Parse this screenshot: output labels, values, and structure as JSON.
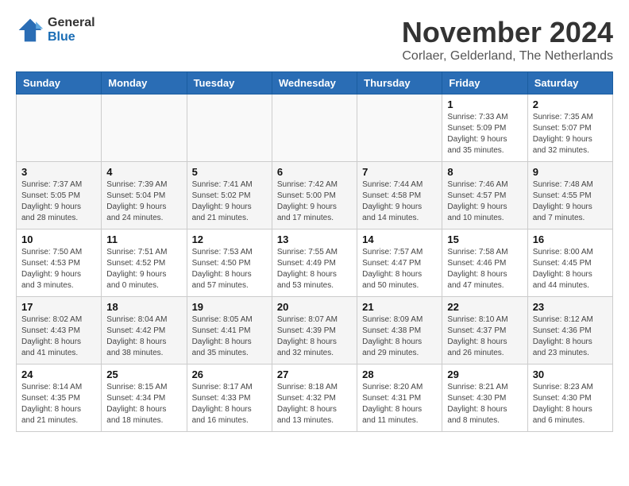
{
  "logo": {
    "general": "General",
    "blue": "Blue"
  },
  "header": {
    "title": "November 2024",
    "subtitle": "Corlaer, Gelderland, The Netherlands"
  },
  "weekdays": [
    "Sunday",
    "Monday",
    "Tuesday",
    "Wednesday",
    "Thursday",
    "Friday",
    "Saturday"
  ],
  "weeks": [
    [
      {
        "day": "",
        "info": ""
      },
      {
        "day": "",
        "info": ""
      },
      {
        "day": "",
        "info": ""
      },
      {
        "day": "",
        "info": ""
      },
      {
        "day": "",
        "info": ""
      },
      {
        "day": "1",
        "info": "Sunrise: 7:33 AM\nSunset: 5:09 PM\nDaylight: 9 hours\nand 35 minutes."
      },
      {
        "day": "2",
        "info": "Sunrise: 7:35 AM\nSunset: 5:07 PM\nDaylight: 9 hours\nand 32 minutes."
      }
    ],
    [
      {
        "day": "3",
        "info": "Sunrise: 7:37 AM\nSunset: 5:05 PM\nDaylight: 9 hours\nand 28 minutes."
      },
      {
        "day": "4",
        "info": "Sunrise: 7:39 AM\nSunset: 5:04 PM\nDaylight: 9 hours\nand 24 minutes."
      },
      {
        "day": "5",
        "info": "Sunrise: 7:41 AM\nSunset: 5:02 PM\nDaylight: 9 hours\nand 21 minutes."
      },
      {
        "day": "6",
        "info": "Sunrise: 7:42 AM\nSunset: 5:00 PM\nDaylight: 9 hours\nand 17 minutes."
      },
      {
        "day": "7",
        "info": "Sunrise: 7:44 AM\nSunset: 4:58 PM\nDaylight: 9 hours\nand 14 minutes."
      },
      {
        "day": "8",
        "info": "Sunrise: 7:46 AM\nSunset: 4:57 PM\nDaylight: 9 hours\nand 10 minutes."
      },
      {
        "day": "9",
        "info": "Sunrise: 7:48 AM\nSunset: 4:55 PM\nDaylight: 9 hours\nand 7 minutes."
      }
    ],
    [
      {
        "day": "10",
        "info": "Sunrise: 7:50 AM\nSunset: 4:53 PM\nDaylight: 9 hours\nand 3 minutes."
      },
      {
        "day": "11",
        "info": "Sunrise: 7:51 AM\nSunset: 4:52 PM\nDaylight: 9 hours\nand 0 minutes."
      },
      {
        "day": "12",
        "info": "Sunrise: 7:53 AM\nSunset: 4:50 PM\nDaylight: 8 hours\nand 57 minutes."
      },
      {
        "day": "13",
        "info": "Sunrise: 7:55 AM\nSunset: 4:49 PM\nDaylight: 8 hours\nand 53 minutes."
      },
      {
        "day": "14",
        "info": "Sunrise: 7:57 AM\nSunset: 4:47 PM\nDaylight: 8 hours\nand 50 minutes."
      },
      {
        "day": "15",
        "info": "Sunrise: 7:58 AM\nSunset: 4:46 PM\nDaylight: 8 hours\nand 47 minutes."
      },
      {
        "day": "16",
        "info": "Sunrise: 8:00 AM\nSunset: 4:45 PM\nDaylight: 8 hours\nand 44 minutes."
      }
    ],
    [
      {
        "day": "17",
        "info": "Sunrise: 8:02 AM\nSunset: 4:43 PM\nDaylight: 8 hours\nand 41 minutes."
      },
      {
        "day": "18",
        "info": "Sunrise: 8:04 AM\nSunset: 4:42 PM\nDaylight: 8 hours\nand 38 minutes."
      },
      {
        "day": "19",
        "info": "Sunrise: 8:05 AM\nSunset: 4:41 PM\nDaylight: 8 hours\nand 35 minutes."
      },
      {
        "day": "20",
        "info": "Sunrise: 8:07 AM\nSunset: 4:39 PM\nDaylight: 8 hours\nand 32 minutes."
      },
      {
        "day": "21",
        "info": "Sunrise: 8:09 AM\nSunset: 4:38 PM\nDaylight: 8 hours\nand 29 minutes."
      },
      {
        "day": "22",
        "info": "Sunrise: 8:10 AM\nSunset: 4:37 PM\nDaylight: 8 hours\nand 26 minutes."
      },
      {
        "day": "23",
        "info": "Sunrise: 8:12 AM\nSunset: 4:36 PM\nDaylight: 8 hours\nand 23 minutes."
      }
    ],
    [
      {
        "day": "24",
        "info": "Sunrise: 8:14 AM\nSunset: 4:35 PM\nDaylight: 8 hours\nand 21 minutes."
      },
      {
        "day": "25",
        "info": "Sunrise: 8:15 AM\nSunset: 4:34 PM\nDaylight: 8 hours\nand 18 minutes."
      },
      {
        "day": "26",
        "info": "Sunrise: 8:17 AM\nSunset: 4:33 PM\nDaylight: 8 hours\nand 16 minutes."
      },
      {
        "day": "27",
        "info": "Sunrise: 8:18 AM\nSunset: 4:32 PM\nDaylight: 8 hours\nand 13 minutes."
      },
      {
        "day": "28",
        "info": "Sunrise: 8:20 AM\nSunset: 4:31 PM\nDaylight: 8 hours\nand 11 minutes."
      },
      {
        "day": "29",
        "info": "Sunrise: 8:21 AM\nSunset: 4:30 PM\nDaylight: 8 hours\nand 8 minutes."
      },
      {
        "day": "30",
        "info": "Sunrise: 8:23 AM\nSunset: 4:30 PM\nDaylight: 8 hours\nand 6 minutes."
      }
    ]
  ]
}
